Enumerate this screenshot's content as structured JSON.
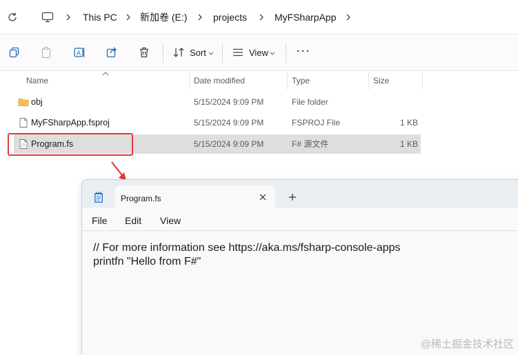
{
  "address_bar": {
    "breadcrumbs": [
      "This PC",
      "新加卷 (E:)",
      "projects",
      "MyFSharpApp"
    ]
  },
  "toolbar": {
    "sort_label": "Sort",
    "view_label": "View",
    "more_label": "···"
  },
  "file_list": {
    "columns": [
      "Name",
      "Date modified",
      "Type",
      "Size"
    ],
    "rows": [
      {
        "name": "obj",
        "date": "5/15/2024 9:09 PM",
        "type": "File folder",
        "size": "",
        "icon": "folder-icon"
      },
      {
        "name": "MyFSharpApp.fsproj",
        "date": "5/15/2024 9:09 PM",
        "type": "FSPROJ File",
        "size": "1 KB",
        "icon": "file-icon"
      },
      {
        "name": "Program.fs",
        "date": "5/15/2024 9:09 PM",
        "type": "F# 源文件",
        "size": "1 KB",
        "icon": "file-icon",
        "selected": true
      }
    ]
  },
  "notepad": {
    "tab_title": "Program.fs",
    "menu": [
      "File",
      "Edit",
      "View"
    ],
    "lines": [
      "// For more information see https://aka.ms/fsharp-console-apps",
      "printfn \"Hello from F#\""
    ]
  },
  "watermark": "@稀土掘金技术社区",
  "colors": {
    "highlight": "#e23b3b",
    "folder": "#f2c14e",
    "accent": "#0067c0"
  }
}
